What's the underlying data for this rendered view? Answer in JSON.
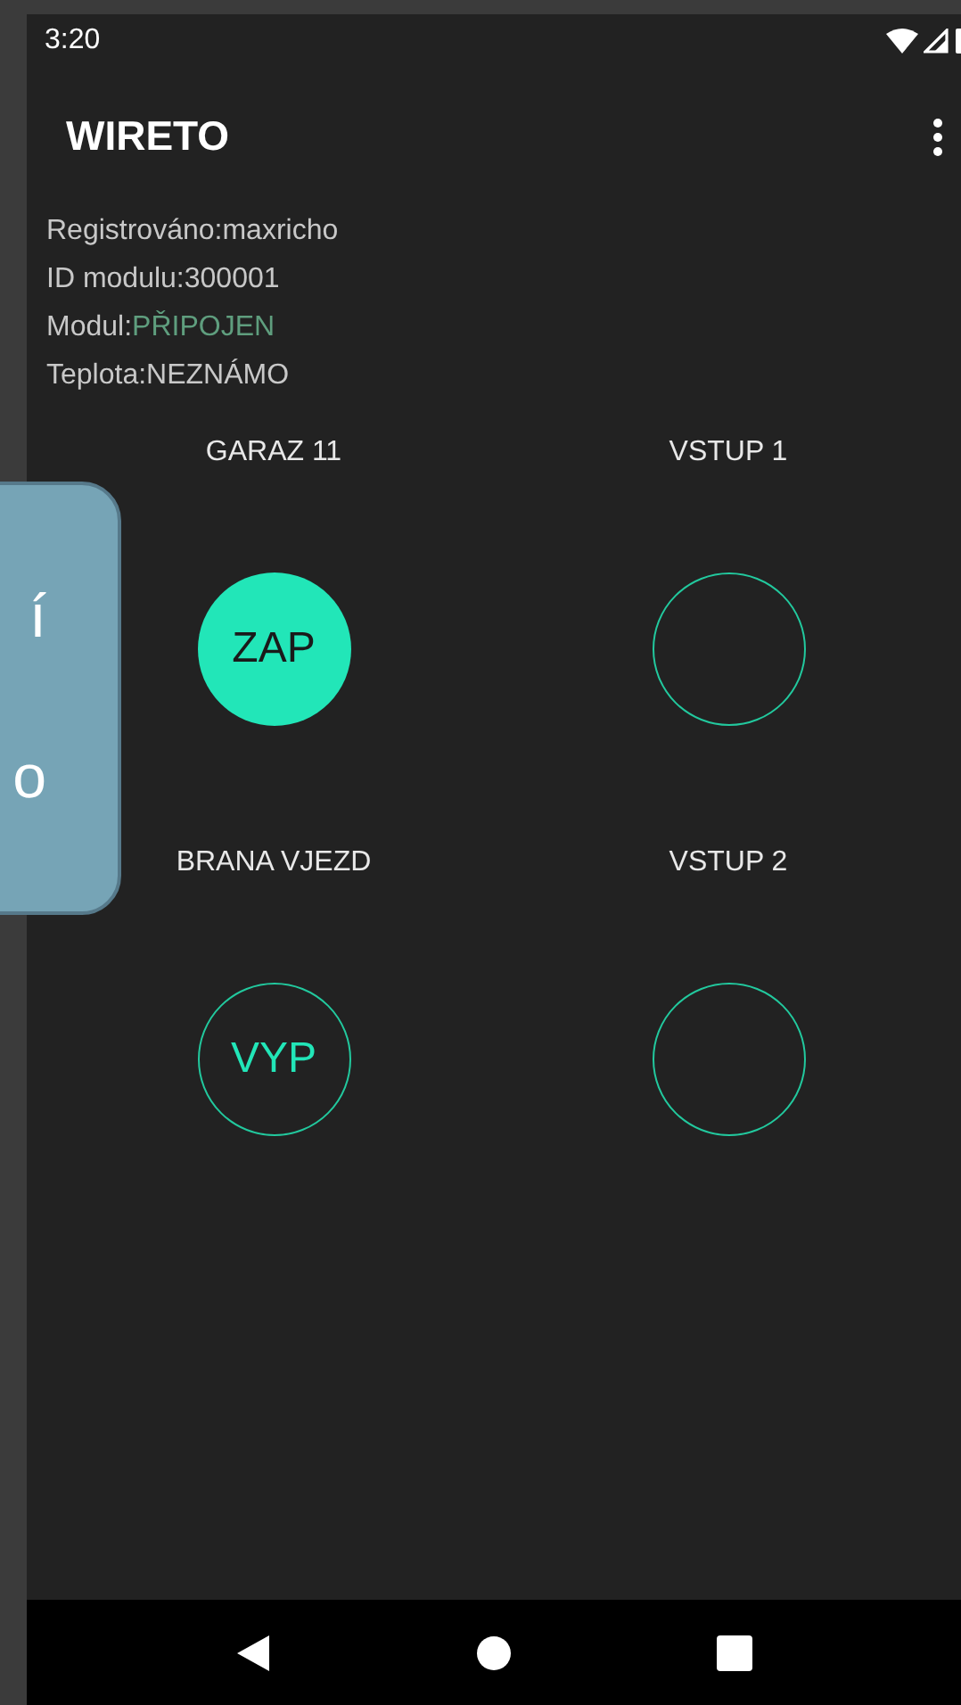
{
  "status_bar": {
    "time": "3:20"
  },
  "app_bar": {
    "title": "WIRETO"
  },
  "info": [
    {
      "label": "Registrováno:",
      "value": "maxricho",
      "highlight": false
    },
    {
      "label": "ID modulu:",
      "value": "300001",
      "highlight": false
    },
    {
      "label": "Modul:",
      "value": "PŘIPOJEN",
      "highlight": true
    },
    {
      "label": "Teplota:",
      "value": "NEZNÁMO",
      "highlight": false
    }
  ],
  "channels": [
    {
      "name": "GARAZ 11",
      "on": true,
      "state_text": "ZAP"
    },
    {
      "name": "VSTUP 1",
      "on": false
    },
    {
      "name": "BRANA VJEZD",
      "on": false,
      "state_text": "VYP"
    },
    {
      "name": "VSTUP 2",
      "on": false
    }
  ],
  "overlay_bubble": {
    "lines": [
      "í",
      "o"
    ]
  }
}
